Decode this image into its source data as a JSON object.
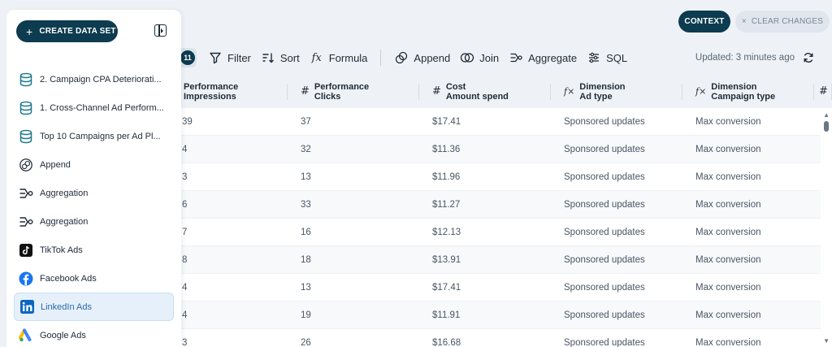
{
  "header": {
    "context_label": "CONTEXT",
    "clear_changes_label": "CLEAR CHANGES",
    "clear_icon": "×"
  },
  "sidebar": {
    "create_button_label": "CREATE DATA SET",
    "create_icon": "+",
    "items": [
      {
        "label": "2. Campaign CPA Deteriorati...",
        "icon": "database-icon"
      },
      {
        "label": "1. Cross-Channel Ad Perform...",
        "icon": "database-icon"
      },
      {
        "label": "Top 10 Campaigns per Ad Pl...",
        "icon": "database-icon"
      },
      {
        "label": "Append",
        "icon": "append-icon"
      },
      {
        "label": "Aggregation",
        "icon": "aggregation-icon"
      },
      {
        "label": "Aggregation",
        "icon": "aggregation-icon"
      },
      {
        "label": "TikTok Ads",
        "icon": "tiktok-icon"
      },
      {
        "label": "Facebook Ads",
        "icon": "facebook-icon"
      },
      {
        "label": "LinkedIn Ads",
        "icon": "linkedin-icon",
        "active": true
      },
      {
        "label": "Google Ads",
        "icon": "google-ads-icon"
      }
    ]
  },
  "toolbar": {
    "badge": "11",
    "filter": "Filter",
    "sort": "Sort",
    "formula": "Formula",
    "append": "Append",
    "join": "Join",
    "aggregate": "Aggregate",
    "sql": "SQL",
    "updated": "Updated: 3 minutes ago"
  },
  "table": {
    "columns": [
      {
        "type": "",
        "line1": "Performance",
        "line2": "Impressions"
      },
      {
        "type": "#",
        "line1": "Performance",
        "line2": "Clicks"
      },
      {
        "type": "#",
        "line1": "Cost",
        "line2": "Amount spend"
      },
      {
        "type": "fx",
        "line1": "Dimension",
        "line2": "Ad type"
      },
      {
        "type": "fx",
        "line1": "Dimension",
        "line2": "Campaign type"
      },
      {
        "type": "#",
        "line1": "",
        "line2": ""
      }
    ],
    "rows": [
      [
        "39",
        "37",
        "$17.41",
        "Sponsored updates",
        "Max conversion"
      ],
      [
        "4",
        "32",
        "$11.36",
        "Sponsored updates",
        "Max conversion"
      ],
      [
        "3",
        "13",
        "$11.96",
        "Sponsored updates",
        "Max conversion"
      ],
      [
        "6",
        "33",
        "$11.27",
        "Sponsored updates",
        "Max conversion"
      ],
      [
        "7",
        "16",
        "$12.13",
        "Sponsored updates",
        "Max conversion"
      ],
      [
        "8",
        "18",
        "$13.91",
        "Sponsored updates",
        "Max conversion"
      ],
      [
        "4",
        "13",
        "$17.41",
        "Sponsored updates",
        "Max conversion"
      ],
      [
        "4",
        "19",
        "$11.91",
        "Sponsored updates",
        "Max conversion"
      ],
      [
        "3",
        "26",
        "$16.68",
        "Sponsored updates",
        "Max conversion"
      ]
    ]
  },
  "colors": {
    "primary": "#0d3b4f",
    "active_bg": "#e6f0fa",
    "active_text": "#2b6aa6",
    "db_icon": "#1f7a8c",
    "facebook": "#1877f2",
    "linkedin": "#0a66c2"
  }
}
